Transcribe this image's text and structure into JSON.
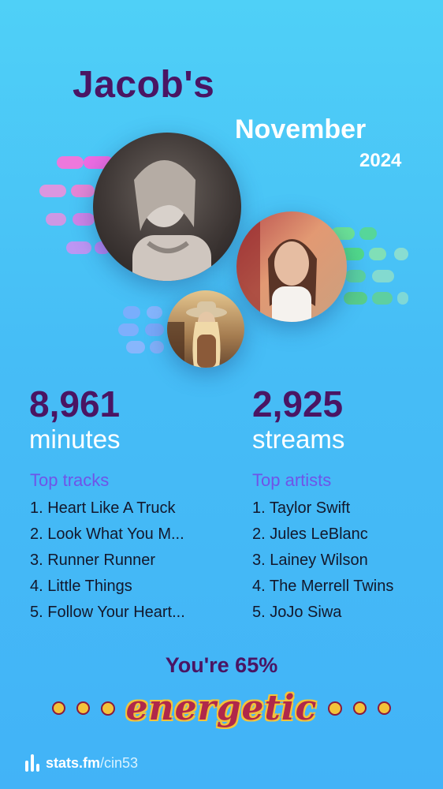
{
  "header": {
    "name": "Jacob's",
    "month": "November",
    "year": "2024"
  },
  "artists_images": [
    {
      "icon": "taylor-swift-photo"
    },
    {
      "icon": "jules-leblanc-photo"
    },
    {
      "icon": "lainey-wilson-photo"
    }
  ],
  "stats": {
    "minutes_value": "8,961",
    "minutes_label": "minutes",
    "streams_value": "2,925",
    "streams_label": "streams"
  },
  "top_tracks": {
    "title": "Top tracks",
    "items": [
      "1. Heart Like A Truck",
      "2. Look What You M...",
      "3. Runner Runner",
      "4. Little Things",
      "5. Follow Your Heart..."
    ]
  },
  "top_artists": {
    "title": "Top artists",
    "items": [
      "1. Taylor Swift",
      "2. Jules LeBlanc",
      "3. Lainey Wilson",
      "4. The Merrell Twins",
      "5. JoJo Siwa"
    ]
  },
  "energy": {
    "prefix": "You're 65%",
    "word": "energetic"
  },
  "footer": {
    "brand": "stats.fm",
    "handle": "/cin53"
  },
  "colors": {
    "background": "#46bdf6",
    "accent_purple": "#4a1563",
    "section_title": "#6f54e8",
    "energy_text": "#b0284a",
    "energy_outline": "#f3c33a"
  }
}
